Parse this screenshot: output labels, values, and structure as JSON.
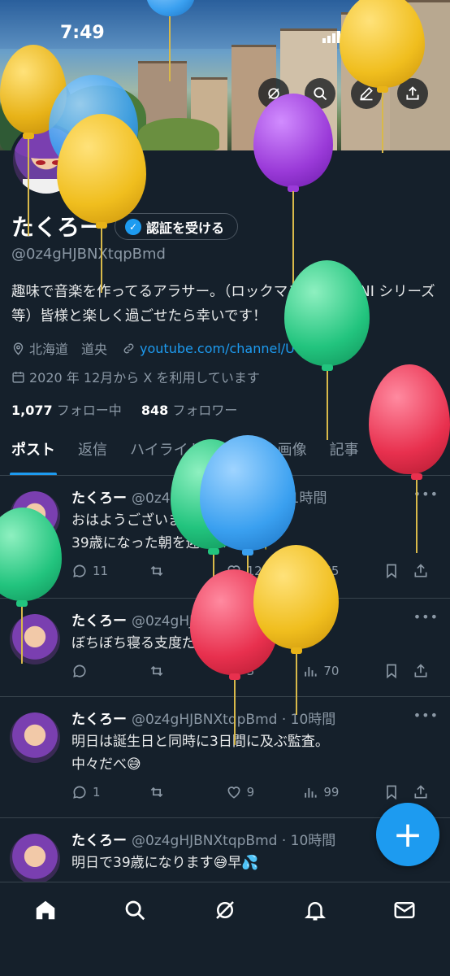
{
  "status_bar": {
    "time": "7:49",
    "network": "4G",
    "battery": "76"
  },
  "profile": {
    "name": "たくろー",
    "verify_label": "認証を受ける",
    "handle": "@0z4gHJBNXtqpBmd",
    "bio": "趣味で音楽を作ってるアラサー。（ロックマン EXE、ONI シリーズ等）皆様と楽しく過ごせたら幸いです！",
    "location": "北海道　道央",
    "link": "youtube.com/channel/UCYhPZ...",
    "joined": "2020 年 12月から X を利用しています",
    "following_count": "1,077",
    "following_label": "フォロー中",
    "followers_count": "848",
    "followers_label": "フォロワー"
  },
  "tabs": [
    "ポスト",
    "返信",
    "ハイライト",
    "動画",
    "画像",
    "記事",
    "いいね"
  ],
  "posts": [
    {
      "name": "たくろー",
      "handle": "@0z4gHJBNXtqpBmd",
      "time": "1時間",
      "text": "おはようございます\n39歳になった朝を迎えました✨",
      "replies": "11",
      "retweets": "",
      "likes": "12",
      "views": "65"
    },
    {
      "name": "たくろー",
      "handle": "@0z4gHJBNXtqpBmd",
      "time": "9時間",
      "text": "ぼちぼち寝る支度だな",
      "replies": "",
      "retweets": "",
      "likes": "3",
      "views": "70"
    },
    {
      "name": "たくろー",
      "handle": "@0z4gHJBNXtqpBmd",
      "time": "10時間",
      "text": "明日は誕生日と同時に3日間に及ぶ監査。\n中々だべ😅",
      "replies": "1",
      "retweets": "",
      "likes": "9",
      "views": "99"
    },
    {
      "name": "たくろー",
      "handle": "@0z4gHJBNXtqpBmd",
      "time": "10時間",
      "text": "明日で39歳になります😅早💦",
      "replies": "",
      "retweets": "",
      "likes": "",
      "views": ""
    }
  ],
  "fab_label": "+",
  "colors": {
    "accent": "#1d9bf0",
    "background": "#15202b"
  },
  "icons": {
    "back": "back-arrow-icon",
    "grok": "grok-icon",
    "search": "search-icon",
    "edit": "edit-icon",
    "share": "share-icon",
    "home": "home-icon",
    "nav_search": "search-icon",
    "nav_grok": "grok-icon",
    "notifications": "bell-icon",
    "messages": "mail-icon"
  }
}
